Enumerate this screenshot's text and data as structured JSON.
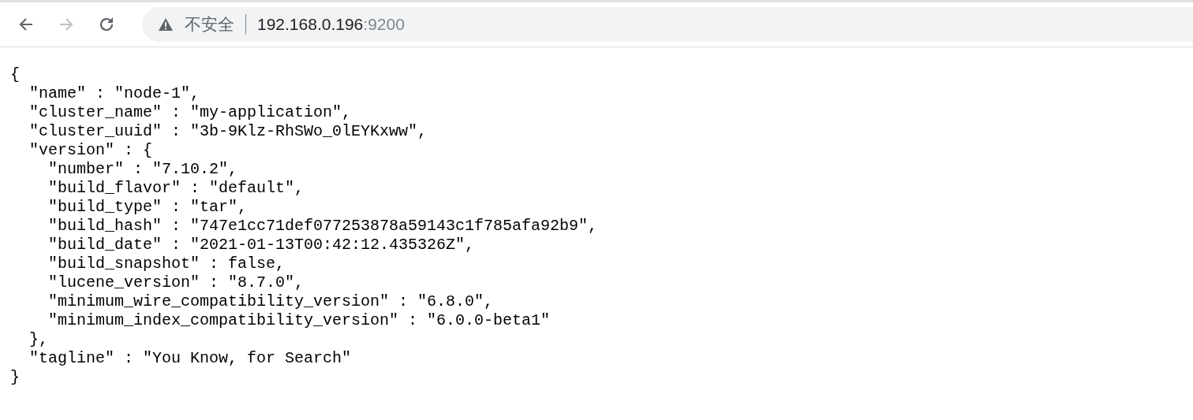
{
  "toolbar": {
    "nav_buttons": [
      {
        "kind": "back",
        "disabled": false
      },
      {
        "kind": "forward",
        "disabled": true
      },
      {
        "kind": "reload",
        "disabled": false
      }
    ],
    "address": {
      "security_label": "不安全",
      "host": "192.168.0.196",
      "port": ":9200"
    }
  },
  "body": {
    "lines": [
      {
        "text": "{",
        "children": [
          {
            "text": "\"name\" : \"node-1\","
          },
          {
            "text": "\"cluster_name\" : \"my-application\","
          },
          {
            "text": "\"cluster_uuid\" : \"3b-9Klz-RhSWo_0lEYKxww\","
          },
          {
            "text": "\"version\" : {",
            "children": [
              {
                "text": "\"number\" : \"7.10.2\","
              },
              {
                "text": "\"build_flavor\" : \"default\","
              },
              {
                "text": "\"build_type\" : \"tar\","
              },
              {
                "text": "\"build_hash\" : \"747e1cc71def077253878a59143c1f785afa92b9\","
              },
              {
                "text": "\"build_date\" : \"2021-01-13T00:42:12.435326Z\","
              },
              {
                "text": "\"build_snapshot\" : false,"
              },
              {
                "text": "\"lucene_version\" : \"8.7.0\","
              },
              {
                "text": "\"minimum_wire_compatibility_version\" : \"6.8.0\","
              },
              {
                "text": "\"minimum_index_compatibility_version\" : \"6.0.0-beta1\""
              }
            ]
          },
          {
            "text": "},"
          },
          {
            "text": "\"tagline\" : \"You Know, for Search\""
          }
        ]
      },
      {
        "text": "}"
      }
    ]
  }
}
